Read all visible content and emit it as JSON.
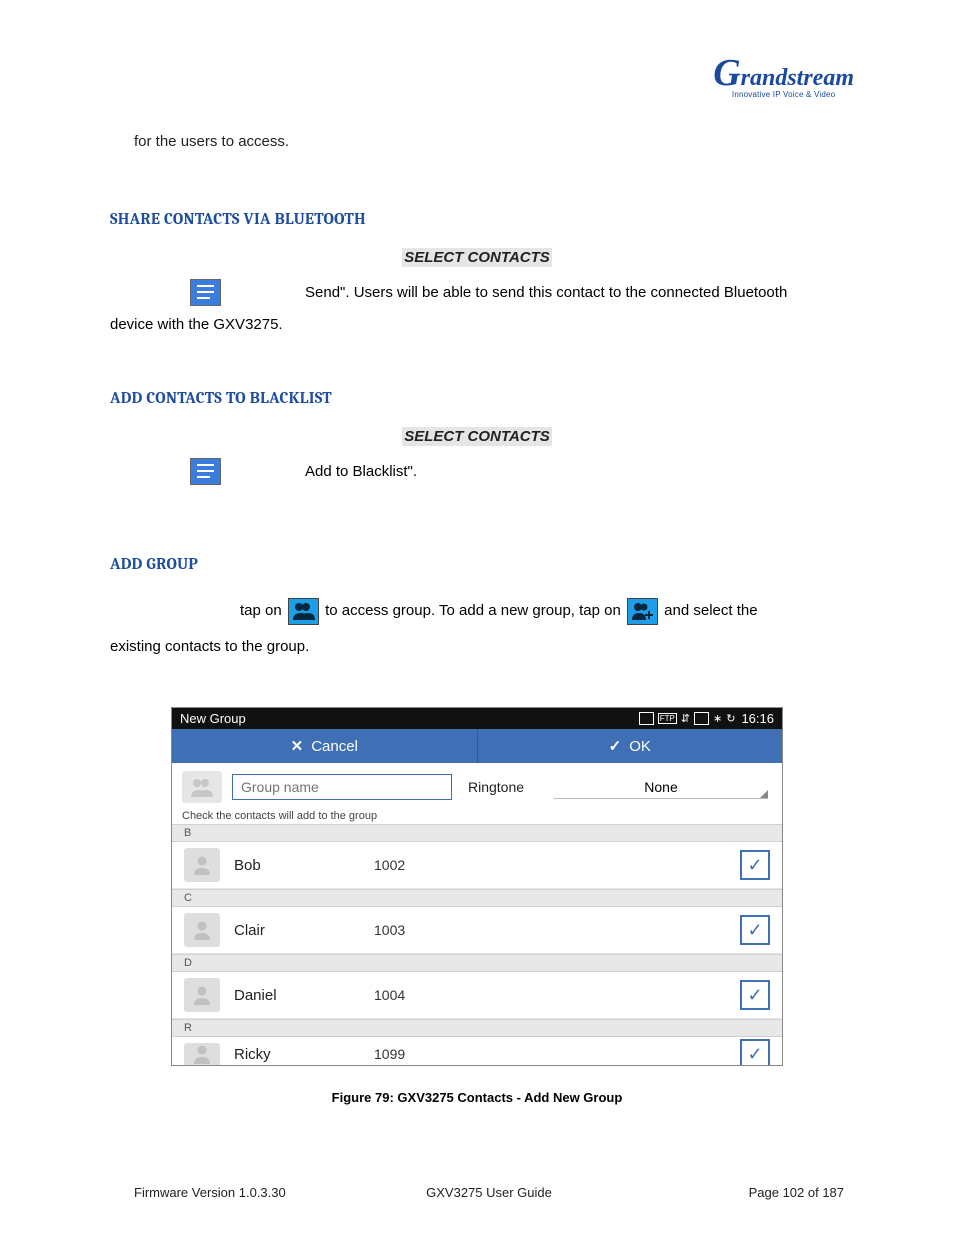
{
  "logo": {
    "tagline": "Innovative IP Voice & Video"
  },
  "intro_text": "for the users to access.",
  "sections": {
    "bluetooth": {
      "heading": "SHARE CONTACTS VIA BLUETOOTH",
      "select_label": "SELECT CONTACTS",
      "text_right": "Send\". Users will be able to send this contact to the connected Bluetooth",
      "text_below": "device with the GXV3275."
    },
    "blacklist": {
      "heading": "ADD CONTACTS TO BLACKLIST",
      "select_label": "SELECT CONTACTS",
      "text_right": "Add to Blacklist\"."
    },
    "addgroup": {
      "heading": "ADD GROUP",
      "text_a": "tap on",
      "text_b": "to access group. To add a new group, tap on",
      "text_c": "and select the",
      "text_d": "existing contacts to the group."
    }
  },
  "screenshot": {
    "titlebar": {
      "title": "New Group",
      "time": "16:16"
    },
    "toolbar": {
      "cancel": "Cancel",
      "ok": "OK"
    },
    "config": {
      "group_placeholder": "Group name",
      "ringtone_label": "Ringtone",
      "ringtone_value": "None",
      "hint": "Check the contacts will add to the group"
    },
    "rows": [
      {
        "divider": "B"
      },
      {
        "name": "Bob",
        "number": "1002",
        "checked": true
      },
      {
        "divider": "C"
      },
      {
        "name": "Clair",
        "number": "1003",
        "checked": true
      },
      {
        "divider": "D"
      },
      {
        "name": "Daniel",
        "number": "1004",
        "checked": true
      },
      {
        "divider": "R"
      },
      {
        "name": "Ricky",
        "number": "1099",
        "checked": true,
        "cut": true
      }
    ]
  },
  "caption": "Figure 79: GXV3275 Contacts - Add New Group",
  "footer": {
    "left": "Firmware Version 1.0.3.30",
    "center": "GXV3275 User Guide",
    "right": "Page 102 of 187"
  }
}
